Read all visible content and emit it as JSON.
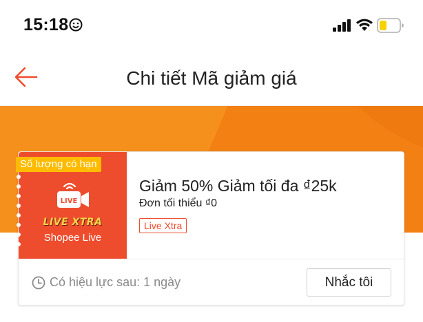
{
  "status_bar": {
    "time": "15:18",
    "emoji_icon": "smiley-icon",
    "signal_icon": "cellular-signal-icon",
    "wifi_icon": "wifi-icon",
    "battery_icon": "battery-low-icon"
  },
  "header": {
    "back_icon": "arrow-left-icon",
    "title": "Chi tiết Mã giảm giá"
  },
  "voucher": {
    "badge": "Số lượng có hạn",
    "logo_text": "LIVE XTRA",
    "cam_label": "LIVE",
    "channel_label": "Shopee Live",
    "title": "Giảm 50% Giảm tối đa ₫25k",
    "min_order": "Đơn tối thiểu ₫0",
    "tag": "Live Xtra",
    "validity": "Có hiệu lực sau: 1 ngày",
    "remind_button": "Nhắc tôi"
  },
  "colors": {
    "brand_orange": "#ee4d2d",
    "banner_orange": "#f38013",
    "badge_yellow": "#ffbb00",
    "battery_yellow": "#f7d100"
  }
}
